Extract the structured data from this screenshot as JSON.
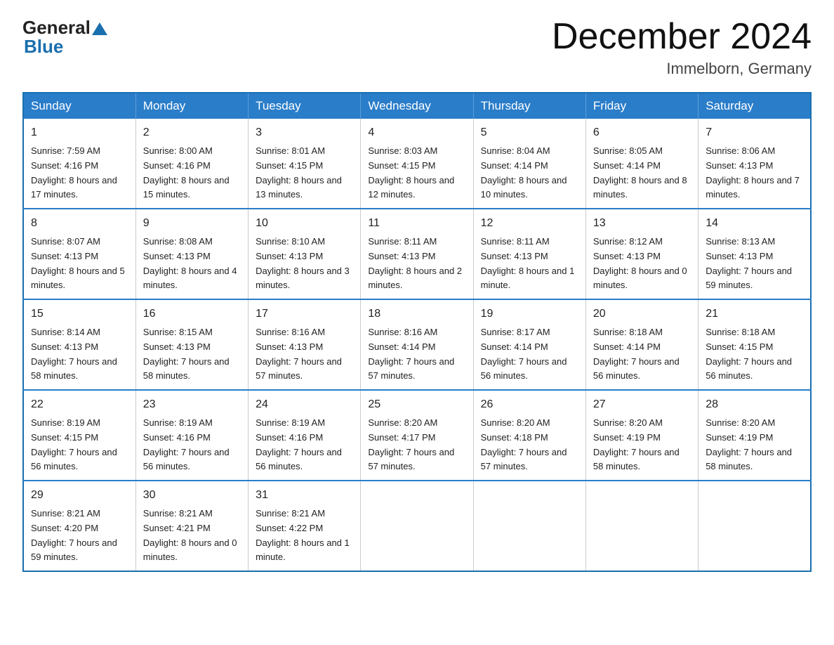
{
  "header": {
    "logo_general": "General",
    "logo_blue": "Blue",
    "title": "December 2024",
    "location": "Immelborn, Germany"
  },
  "weekdays": [
    "Sunday",
    "Monday",
    "Tuesday",
    "Wednesday",
    "Thursday",
    "Friday",
    "Saturday"
  ],
  "weeks": [
    [
      {
        "day": "1",
        "sunrise": "7:59 AM",
        "sunset": "4:16 PM",
        "daylight": "8 hours and 17 minutes."
      },
      {
        "day": "2",
        "sunrise": "8:00 AM",
        "sunset": "4:16 PM",
        "daylight": "8 hours and 15 minutes."
      },
      {
        "day": "3",
        "sunrise": "8:01 AM",
        "sunset": "4:15 PM",
        "daylight": "8 hours and 13 minutes."
      },
      {
        "day": "4",
        "sunrise": "8:03 AM",
        "sunset": "4:15 PM",
        "daylight": "8 hours and 12 minutes."
      },
      {
        "day": "5",
        "sunrise": "8:04 AM",
        "sunset": "4:14 PM",
        "daylight": "8 hours and 10 minutes."
      },
      {
        "day": "6",
        "sunrise": "8:05 AM",
        "sunset": "4:14 PM",
        "daylight": "8 hours and 8 minutes."
      },
      {
        "day": "7",
        "sunrise": "8:06 AM",
        "sunset": "4:13 PM",
        "daylight": "8 hours and 7 minutes."
      }
    ],
    [
      {
        "day": "8",
        "sunrise": "8:07 AM",
        "sunset": "4:13 PM",
        "daylight": "8 hours and 5 minutes."
      },
      {
        "day": "9",
        "sunrise": "8:08 AM",
        "sunset": "4:13 PM",
        "daylight": "8 hours and 4 minutes."
      },
      {
        "day": "10",
        "sunrise": "8:10 AM",
        "sunset": "4:13 PM",
        "daylight": "8 hours and 3 minutes."
      },
      {
        "day": "11",
        "sunrise": "8:11 AM",
        "sunset": "4:13 PM",
        "daylight": "8 hours and 2 minutes."
      },
      {
        "day": "12",
        "sunrise": "8:11 AM",
        "sunset": "4:13 PM",
        "daylight": "8 hours and 1 minute."
      },
      {
        "day": "13",
        "sunrise": "8:12 AM",
        "sunset": "4:13 PM",
        "daylight": "8 hours and 0 minutes."
      },
      {
        "day": "14",
        "sunrise": "8:13 AM",
        "sunset": "4:13 PM",
        "daylight": "7 hours and 59 minutes."
      }
    ],
    [
      {
        "day": "15",
        "sunrise": "8:14 AM",
        "sunset": "4:13 PM",
        "daylight": "7 hours and 58 minutes."
      },
      {
        "day": "16",
        "sunrise": "8:15 AM",
        "sunset": "4:13 PM",
        "daylight": "7 hours and 58 minutes."
      },
      {
        "day": "17",
        "sunrise": "8:16 AM",
        "sunset": "4:13 PM",
        "daylight": "7 hours and 57 minutes."
      },
      {
        "day": "18",
        "sunrise": "8:16 AM",
        "sunset": "4:14 PM",
        "daylight": "7 hours and 57 minutes."
      },
      {
        "day": "19",
        "sunrise": "8:17 AM",
        "sunset": "4:14 PM",
        "daylight": "7 hours and 56 minutes."
      },
      {
        "day": "20",
        "sunrise": "8:18 AM",
        "sunset": "4:14 PM",
        "daylight": "7 hours and 56 minutes."
      },
      {
        "day": "21",
        "sunrise": "8:18 AM",
        "sunset": "4:15 PM",
        "daylight": "7 hours and 56 minutes."
      }
    ],
    [
      {
        "day": "22",
        "sunrise": "8:19 AM",
        "sunset": "4:15 PM",
        "daylight": "7 hours and 56 minutes."
      },
      {
        "day": "23",
        "sunrise": "8:19 AM",
        "sunset": "4:16 PM",
        "daylight": "7 hours and 56 minutes."
      },
      {
        "day": "24",
        "sunrise": "8:19 AM",
        "sunset": "4:16 PM",
        "daylight": "7 hours and 56 minutes."
      },
      {
        "day": "25",
        "sunrise": "8:20 AM",
        "sunset": "4:17 PM",
        "daylight": "7 hours and 57 minutes."
      },
      {
        "day": "26",
        "sunrise": "8:20 AM",
        "sunset": "4:18 PM",
        "daylight": "7 hours and 57 minutes."
      },
      {
        "day": "27",
        "sunrise": "8:20 AM",
        "sunset": "4:19 PM",
        "daylight": "7 hours and 58 minutes."
      },
      {
        "day": "28",
        "sunrise": "8:20 AM",
        "sunset": "4:19 PM",
        "daylight": "7 hours and 58 minutes."
      }
    ],
    [
      {
        "day": "29",
        "sunrise": "8:21 AM",
        "sunset": "4:20 PM",
        "daylight": "7 hours and 59 minutes."
      },
      {
        "day": "30",
        "sunrise": "8:21 AM",
        "sunset": "4:21 PM",
        "daylight": "8 hours and 0 minutes."
      },
      {
        "day": "31",
        "sunrise": "8:21 AM",
        "sunset": "4:22 PM",
        "daylight": "8 hours and 1 minute."
      },
      null,
      null,
      null,
      null
    ]
  ],
  "labels": {
    "sunrise": "Sunrise:",
    "sunset": "Sunset:",
    "daylight": "Daylight:"
  }
}
